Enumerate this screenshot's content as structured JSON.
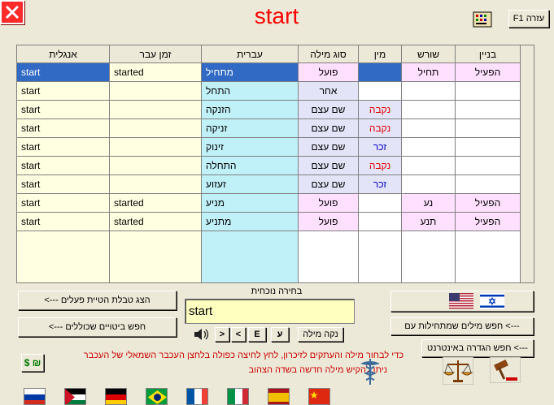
{
  "header": {
    "title": "start",
    "help_label": "F1 עזרה",
    "close_icon": "close-icon",
    "keyboard_icon": "keyboard-icon"
  },
  "grid": {
    "columns": [
      "אנגלית",
      "זמן עבר",
      "עברית",
      "סוג מילה",
      "מין",
      "שורש",
      "בניין"
    ],
    "rows": [
      {
        "english": "start",
        "past": "started",
        "hebrew": "מתחיל",
        "type": "פועל",
        "gender": "",
        "root": "תחיל",
        "binyan": "הפעיל",
        "selected": true
      },
      {
        "english": "start",
        "past": "",
        "hebrew": "התחל",
        "type": "אחר",
        "gender": "",
        "root": "",
        "binyan": ""
      },
      {
        "english": "start",
        "past": "",
        "hebrew": "הזנקה",
        "type": "שם עצם",
        "gender": "נקבה",
        "root": "",
        "binyan": ""
      },
      {
        "english": "start",
        "past": "",
        "hebrew": "זניקה",
        "type": "שם עצם",
        "gender": "נקבה",
        "root": "",
        "binyan": ""
      },
      {
        "english": "start",
        "past": "",
        "hebrew": "זינוק",
        "type": "שם עצם",
        "gender": "זכר",
        "root": "",
        "binyan": ""
      },
      {
        "english": "start",
        "past": "",
        "hebrew": "התחלה",
        "type": "שם עצם",
        "gender": "נקבה",
        "root": "",
        "binyan": ""
      },
      {
        "english": "start",
        "past": "",
        "hebrew": "זעזוע",
        "type": "שם עצם",
        "gender": "זכר",
        "root": "",
        "binyan": ""
      },
      {
        "english": "start",
        "past": "started",
        "hebrew": "מניע",
        "type": "פועל",
        "gender": "",
        "root": "נע",
        "binyan": "הפעיל"
      },
      {
        "english": "start",
        "past": "started",
        "hebrew": "מתניע",
        "type": "פועל",
        "gender": "",
        "root": "תנע",
        "binyan": "הפעיל"
      }
    ]
  },
  "controls": {
    "show_table_btn": "<--- הצג טבלת הטיית פעלים",
    "search_idioms_btn": "<--- חפש ביטויים שכוללים",
    "current_choice_label": "בחירה נוכחית",
    "word_value": "start",
    "clear_word_btn": "נקה מילה",
    "hebrew_btn": "ע",
    "english_btn": "E",
    "prev_btn": "<",
    "next_btn": ">",
    "search_starts_btn": "חפש מילים שמתחילות עם <---",
    "search_internet_btn": "חפש הגדרה באינטרנט <---",
    "currency_label": "$ ₪"
  },
  "notes": {
    "line1": "כדי לבחור מילה והעתקים לזיכרון, לחץ לחיצה כפולה בלחצן העכבר השמאלי של העכבר",
    "line2": "ניתן להקיש מילה חדשה בשדה הצהוב"
  },
  "colors": {
    "title": "#ff0000",
    "selected_bg": "#316ac5",
    "english_col_bg": "#ffffe1",
    "hebrew_col_bg": "#c0f0f8",
    "type_col_bg": "#ffe0ff",
    "gender_col_bg": "#e4e4f8",
    "verb_bg": "#ffe0ff",
    "feminine": "#e00000",
    "masculine": "#0000c0"
  }
}
